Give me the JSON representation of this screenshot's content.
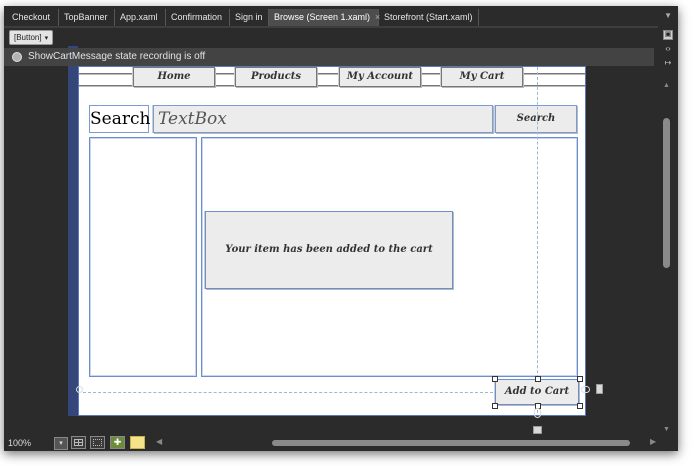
{
  "tabs": [
    {
      "label": "Checkout",
      "active": false
    },
    {
      "label": "TopBanner",
      "active": false
    },
    {
      "label": "App.xaml",
      "active": false
    },
    {
      "label": "Confirmation",
      "active": false
    },
    {
      "label": "Sign in",
      "active": false
    },
    {
      "label": "Browse (Screen 1.xaml)",
      "active": true,
      "close": "×"
    },
    {
      "label": "Storefront (Start.xaml)",
      "active": false
    }
  ],
  "tab_overflow_icon": "chevron-down-icon",
  "toolbar": {
    "element_selector": "[Button]",
    "dropdown_arrow": "▾"
  },
  "state_bar": {
    "text": "ShowCartMessage state recording is off",
    "indicator_color": "#bdbdbd"
  },
  "sketch": {
    "nav": [
      "Home",
      "Products",
      "My Account",
      "My Cart"
    ],
    "search_label": "Search",
    "textbox_text": "TextBox",
    "search_button": "Search",
    "message": "Your item has been added to the cart",
    "add_to_cart": "Add to Cart"
  },
  "status": {
    "zoom": "100%",
    "zoom_arrow": "▾",
    "artboard_color": "#f3e48c"
  },
  "colors": {
    "chrome": "#2b2b2b",
    "selection": "#5b79b8",
    "sketch_fill": "#ececec"
  }
}
